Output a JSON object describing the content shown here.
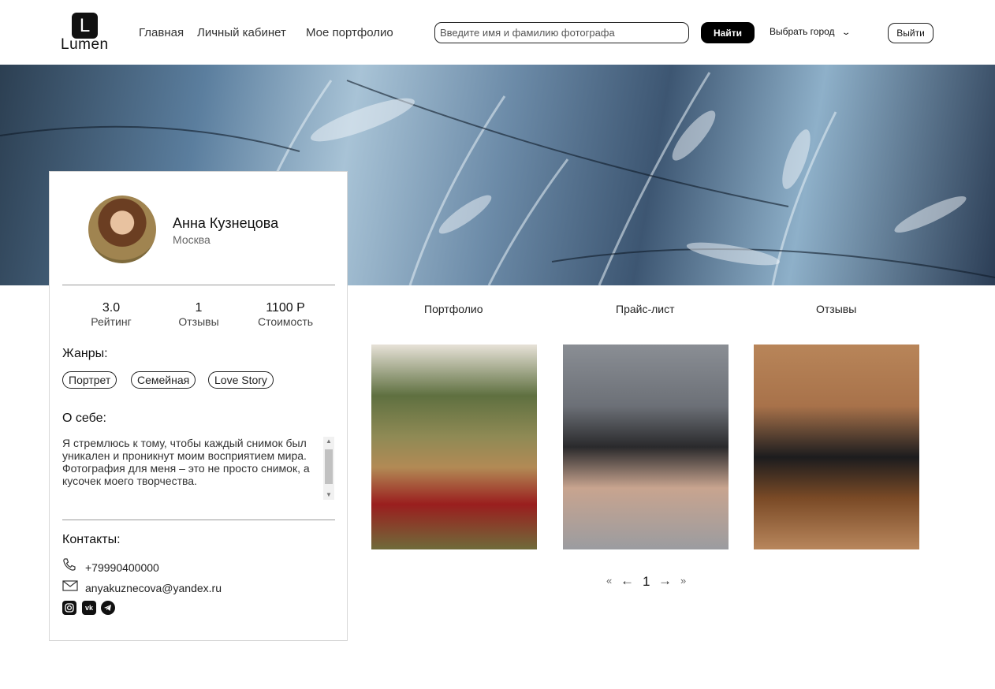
{
  "header": {
    "logo_letter": "L",
    "logo_text": "Lumen",
    "nav": [
      "Главная",
      "Личный кабинет",
      "Мое портфолио"
    ],
    "search_placeholder": "Введите имя и фамилию фотографа",
    "find_label": "Найти",
    "city_label": "Выбрать город",
    "exit_label": "Выйти"
  },
  "profile": {
    "name": "Анна Кузнецова",
    "city": "Москва",
    "stats": [
      {
        "value": "3.0",
        "label": "Рейтинг"
      },
      {
        "value": "1",
        "label": "Отзывы"
      },
      {
        "value": "1100 Р",
        "label": "Стоимость"
      }
    ],
    "genres_title": "Жанры:",
    "genres": [
      "Портрет",
      "Семейная",
      "Love Story"
    ],
    "about_title": "О себе:",
    "about_text": "Я стремлюсь к тому, чтобы каждый снимок был уникален и проникнут моим восприятием мира. Фотография для меня – это не просто снимок, а кусочек моего творчества.",
    "contacts_title": "Контакты:",
    "phone": "+79990400000",
    "email": "anyakuznecova@yandex.ru",
    "socials": [
      "instagram-icon",
      "vk-icon",
      "telegram-icon"
    ]
  },
  "tabs": [
    "Портфолио",
    "Прайс-лист",
    "Отзывы"
  ],
  "pagination": {
    "first": "«",
    "prev": "←",
    "current": "1",
    "next": "→",
    "last": "»"
  }
}
